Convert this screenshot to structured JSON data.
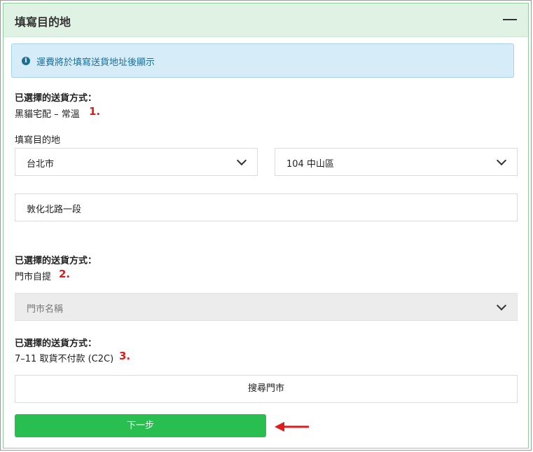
{
  "panel": {
    "title": "填寫目的地"
  },
  "notice": {
    "text": "運費將於填寫送貨地址後顯示",
    "icon": "info-icon"
  },
  "section_home": {
    "shipping_label": "已選擇的送貨方式：",
    "method": "黑貓宅配 – 常溫",
    "marker": "1.",
    "destination_label": "填寫目的地",
    "city": "台北市",
    "district": "104 中山區",
    "address": "敦化北路一段"
  },
  "section_store": {
    "shipping_label": "已選擇的送貨方式：",
    "method": "門市自提",
    "marker": "2.",
    "store_placeholder": "門市名稱"
  },
  "section_c2c": {
    "shipping_label": "已選擇的送貨方式：",
    "method": "7–11 取貨不付款 (C2C)",
    "marker": "3.",
    "search_button": "搜尋門市"
  },
  "footer": {
    "next_button": "下一步"
  },
  "colors": {
    "header_bg": "#e0f2e3",
    "notice_bg": "#d6ecf8",
    "notice_text": "#1a6f97",
    "primary_button": "#28be50",
    "marker": "#e01b1b"
  }
}
